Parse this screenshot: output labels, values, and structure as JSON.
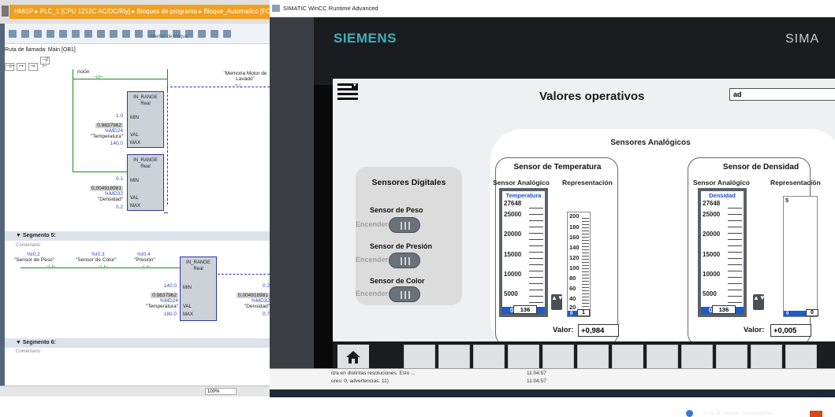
{
  "tia": {
    "breadcrumb": "HMI1P ▸ PLC_1 [CPU 1212C AC/DC/Rly] ▸ Bloques de programa ▸ Bloque_Automatico [FC1]",
    "interface_label": "Interfaz de bloque",
    "call_path": "Ruta de llamada: Main [OB1]",
    "mini_icons": [
      "⊣⊢",
      "↦",
      "⊸",
      "⊣/⊢"
    ],
    "segment5_title": "Segmento 5:",
    "segment6_title": "Segmento 6:",
    "comment_label": "Comentario",
    "zoom": "100%",
    "rung1": {
      "contact_top": "rición",
      "coil_label": "\"Memoria Motor de Lavado\"",
      "block1_title": "IN_RANGE",
      "block1_type": "Real",
      "min_val": "1.0",
      "val_address": "%MD24",
      "val_value": "0.9837962",
      "val_name": "\"Temperatura\"",
      "max_val": "140.0",
      "block2_title": "IN_RANGE",
      "block2_type": "Real",
      "min2_val": "0.1",
      "val2_address": "%MD32",
      "val2_value": "0.004918981",
      "val2_name": "\"Densidad\"",
      "max2_val": "0.2",
      "pin_min": "MIN",
      "pin_val": "VAL",
      "pin_max": "MAX"
    },
    "rung5": {
      "c1_addr": "%I0.2",
      "c1_name": "\"Sensor de Peso\"",
      "c2_addr": "%I0.3",
      "c2_name": "\"Sensor de Color\"",
      "c3_addr": "%I0.4",
      "c3_name": "\"Presión\"",
      "block_title": "IN_RANGE",
      "block_type": "Real",
      "min_val": "140.0",
      "val_value": "0.9837962",
      "val_address": "%MD24",
      "val_name": "\"Temperatura\"",
      "max_val": "180.0",
      "r_min": "0.2",
      "r_val_value": "0.004918981",
      "r_val_address": "%MD32",
      "r_val_name": "\"Densidad\"",
      "r_max": "0.7"
    }
  },
  "window": {
    "title": "SIMATIC WinCC Runtime Advanced"
  },
  "hmi": {
    "brand": "SIEMENS",
    "brand_right": "SIMA",
    "menu_badge": "▼",
    "page_title": "Valores operativos",
    "search_value": "ad",
    "digital": {
      "title": "Sensores Digitales",
      "items": [
        {
          "label": "Sensor de Peso",
          "state": "Encender"
        },
        {
          "label": "Sensor de Presión",
          "state": "Encender"
        },
        {
          "label": "Sensor de Color",
          "state": "Encender"
        }
      ]
    },
    "analog_title": "Sensores Analógicos",
    "temperature": {
      "title": "Sensor de Temperatura",
      "col_analog": "Sensor Analógico",
      "col_repr": "Representación",
      "gauge_label": "Temperatura",
      "gauge_ticks": [
        "27648",
        "25000",
        "20000",
        "15000",
        "10000",
        "5000"
      ],
      "gauge_min": "0",
      "gauge_value": "136",
      "repr_ticks": [
        "200",
        "180",
        "160",
        "140",
        "120",
        "100",
        "80",
        "60",
        "40",
        "20"
      ],
      "repr_min": "0",
      "repr_value": "1",
      "valor_label": "Valor:",
      "valor": "+0,984"
    },
    "density": {
      "title": "Sensor de Densidad",
      "col_analog": "Sensor Analógico",
      "col_repr": "Representación",
      "gauge_label": "Densidad",
      "gauge_ticks": [
        "27648",
        "25000",
        "20000",
        "15000",
        "10000",
        "5000"
      ],
      "gauge_min": "0",
      "gauge_value": "136",
      "repr_top": "5",
      "repr_min": "0",
      "repr_value": "0",
      "valor_label": "Valor:",
      "valor": "+0,005"
    },
    "stepper_glyph": "▲▼"
  },
  "output_log": {
    "row1": "ilza en distintas resoluciones. Esto ...",
    "row1_time": "11:04:57",
    "row2": "ores: 0; advertencias: 11)",
    "row2_time": "11:04:57",
    "error_text": "Error al cambiar la contraseña"
  },
  "colors": {
    "breadcrumb_bg": "#f0a020",
    "siemens_teal": "#3fb0b8",
    "gauge_blue": "#1a5cc8",
    "ladder_green": "#1a8a1a"
  }
}
